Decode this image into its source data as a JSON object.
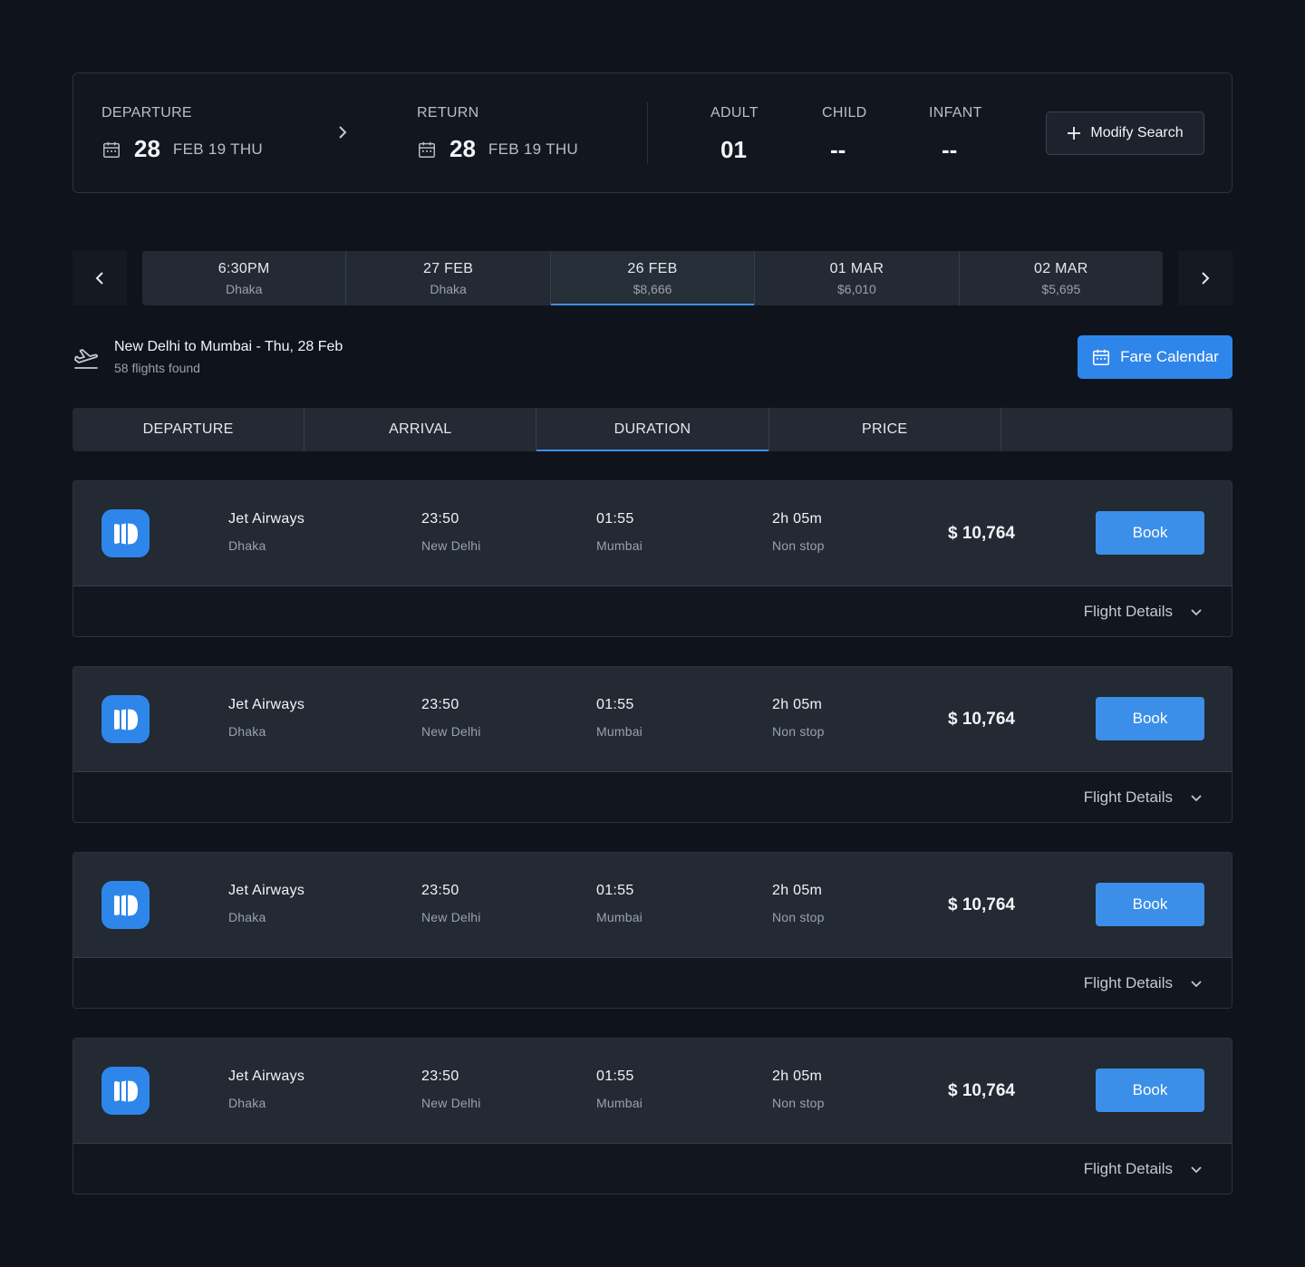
{
  "search": {
    "departure_label": "DEPARTURE",
    "departure_day": "28",
    "departure_date": "FEB 19 THU",
    "return_label": "RETURN",
    "return_day": "28",
    "return_date": "FEB 19 THU",
    "adult_label": "ADULT",
    "adult_count": "01",
    "child_label": "CHILD",
    "child_count": "--",
    "infant_label": "INFANT",
    "infant_count": "--",
    "modify_label": "Modify Search"
  },
  "date_strip": [
    {
      "main": "6:30PM",
      "sub": "Dhaka",
      "active": false
    },
    {
      "main": "27 FEB",
      "sub": "Dhaka",
      "active": false
    },
    {
      "main": "26 FEB",
      "sub": "$8,666",
      "active": true
    },
    {
      "main": "01 MAR",
      "sub": "$6,010",
      "active": false
    },
    {
      "main": "02 MAR",
      "sub": "$5,695",
      "active": false
    }
  ],
  "route": {
    "title": "New Delhi to Mumbai - Thu, 28 Feb",
    "count": "58 flights found",
    "fare_calendar_label": "Fare Calendar"
  },
  "sort_tabs": [
    {
      "label": "DEPARTURE",
      "active": false
    },
    {
      "label": "ARRIVAL",
      "active": false
    },
    {
      "label": "DURATION",
      "active": true
    },
    {
      "label": "PRICE",
      "active": false
    },
    {
      "label": "",
      "active": false
    }
  ],
  "flights": [
    {
      "airline": "Jet Airways",
      "airline_city": "Dhaka",
      "dep_time": "23:50",
      "dep_city": "New Delhi",
      "arr_time": "01:55",
      "arr_city": "Mumbai",
      "duration": "2h 05m",
      "stops": "Non stop",
      "price": "$ 10,764",
      "book_label": "Book",
      "details_label": "Flight Details"
    },
    {
      "airline": "Jet Airways",
      "airline_city": "Dhaka",
      "dep_time": "23:50",
      "dep_city": "New Delhi",
      "arr_time": "01:55",
      "arr_city": "Mumbai",
      "duration": "2h 05m",
      "stops": "Non stop",
      "price": "$ 10,764",
      "book_label": "Book",
      "details_label": "Flight Details"
    },
    {
      "airline": "Jet Airways",
      "airline_city": "Dhaka",
      "dep_time": "23:50",
      "dep_city": "New Delhi",
      "arr_time": "01:55",
      "arr_city": "Mumbai",
      "duration": "2h 05m",
      "stops": "Non stop",
      "price": "$ 10,764",
      "book_label": "Book",
      "details_label": "Flight Details"
    },
    {
      "airline": "Jet Airways",
      "airline_city": "Dhaka",
      "dep_time": "23:50",
      "dep_city": "New Delhi",
      "arr_time": "01:55",
      "arr_city": "Mumbai",
      "duration": "2h 05m",
      "stops": "Non stop",
      "price": "$ 10,764",
      "book_label": "Book",
      "details_label": "Flight Details"
    }
  ],
  "icons": {
    "calendar": "calendar-icon",
    "chevron_right": "chevron-right-icon",
    "chevron_left": "chevron-left-icon",
    "plus": "plus-icon",
    "takeoff": "takeoff-icon",
    "chevron_down": "chevron-down-icon",
    "airline_logo": "airline-logo-icon"
  },
  "colors": {
    "background": "#0f141c",
    "panel": "#232a33",
    "accent": "#3b8fe8",
    "text": "#e6e9ee",
    "muted": "#9aa1ab"
  }
}
